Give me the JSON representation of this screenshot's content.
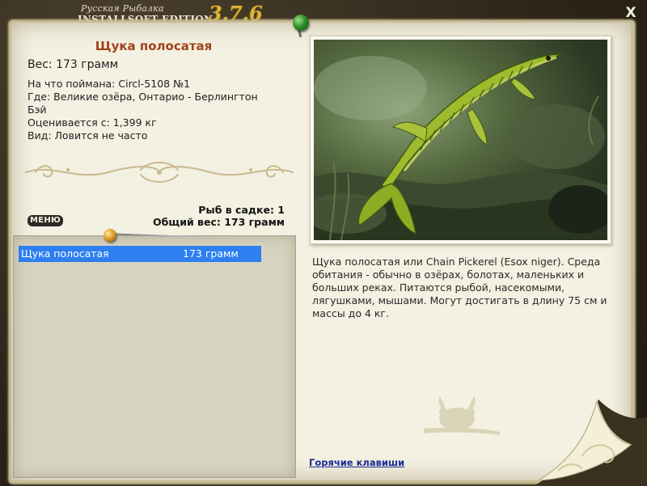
{
  "header": {
    "brand_line1": "Русская Рыбалка",
    "brand_line2": "INSTALLSOFT EDITION",
    "version": "3.7.6",
    "close_label": "X"
  },
  "fish": {
    "title": "Щука полосатая",
    "weight_line": "Вес: 173 грамм",
    "caught_on": "На что поймана: Circl-5108 №1",
    "location_line1": "Где: Великие озёра, Онтарио - Берлингтон",
    "location_line2": "Бэй",
    "valued_from": "Оценивается с: 1,399 кг",
    "kind": "Вид: Ловится не часто"
  },
  "summary": {
    "count_line": "Рыб в садке: 1",
    "total_line": "Общий вес: 173 грамм"
  },
  "menu": {
    "label": "МЕНЮ"
  },
  "catch_list": [
    {
      "name": "Щука полосатая",
      "weight": "173 грамм",
      "selected": true
    }
  ],
  "description": "Щука полосатая или Chain Pickerel (Esox niger). Среда обитания - обычно в озёрах, болотах, маленьких и больших реках. Питаются рыбой, насекомыми, лягушками, мышами. Могут достигать в длину 75 см и массы до 4 кг.",
  "hotkeys_link": "Горячие клавиши",
  "colors": {
    "title": "#a0421a",
    "selection": "#2d7ff2",
    "link": "#1b2a9a",
    "version": "#d9b43a"
  }
}
